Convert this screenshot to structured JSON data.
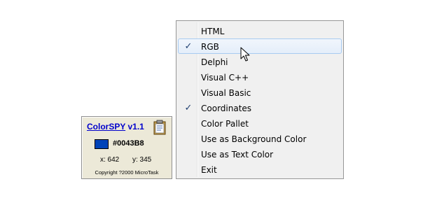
{
  "widget": {
    "app_name": "ColorSPY",
    "version": "v1.1",
    "color_hex": "#0043B8",
    "swatch_color": "#0043B8",
    "x_label": "x: 642",
    "y_label": "y: 345",
    "copyright": "Copyright ?2000 MicroTask",
    "icon": "clipboard-icon"
  },
  "menu": {
    "items": [
      {
        "label": "HTML",
        "checked": false
      },
      {
        "label": "RGB",
        "checked": true,
        "hover": true
      },
      {
        "label": "Delphi",
        "checked": false
      },
      {
        "label": "Visual C++",
        "checked": false
      },
      {
        "label": "Visual Basic",
        "checked": false
      },
      {
        "label": "Coordinates",
        "checked": true
      },
      {
        "label": "Color Pallet",
        "checked": false
      },
      {
        "label": "Use as Background Color",
        "checked": false
      },
      {
        "label": "Use as Text Color",
        "checked": false
      },
      {
        "label": "Exit",
        "checked": false
      }
    ],
    "check_glyph": "✓",
    "hover_border": "#a8cbf1"
  }
}
